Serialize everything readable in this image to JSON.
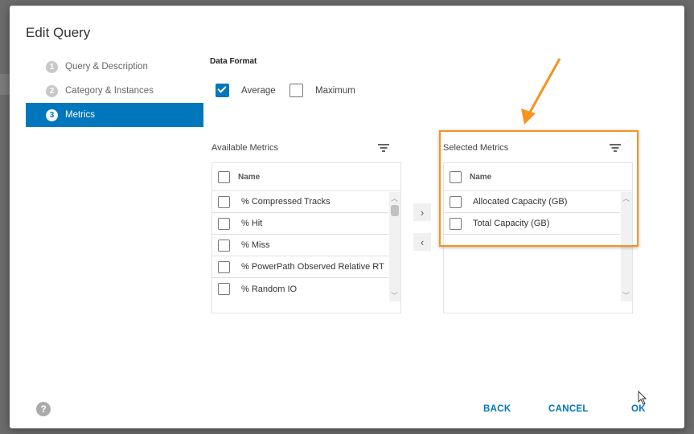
{
  "dialog": {
    "title": "Edit Query"
  },
  "steps": [
    {
      "num": "1",
      "label": "Query & Description"
    },
    {
      "num": "2",
      "label": "Category & Instances"
    },
    {
      "num": "3",
      "label": "Metrics",
      "active": true
    }
  ],
  "data_format": {
    "label": "Data Format",
    "options": [
      {
        "label": "Average",
        "checked": true
      },
      {
        "label": "Maximum",
        "checked": false
      }
    ]
  },
  "available": {
    "title": "Available Metrics",
    "header": "Name",
    "items": [
      "% Compressed Tracks",
      "% Hit",
      "% Miss",
      "% PowerPath Observed Relative RT",
      "% Random IO"
    ]
  },
  "selected": {
    "title": "Selected Metrics",
    "header": "Name",
    "items": [
      "Allocated Capacity (GB)",
      "Total Capacity (GB)"
    ]
  },
  "move": {
    "add": "›",
    "remove": "‹"
  },
  "footer": {
    "help": "?",
    "back": "BACK",
    "cancel": "CANCEL",
    "ok": "OK"
  },
  "colors": {
    "accent": "#0076bd",
    "highlight": "#f7931e"
  }
}
